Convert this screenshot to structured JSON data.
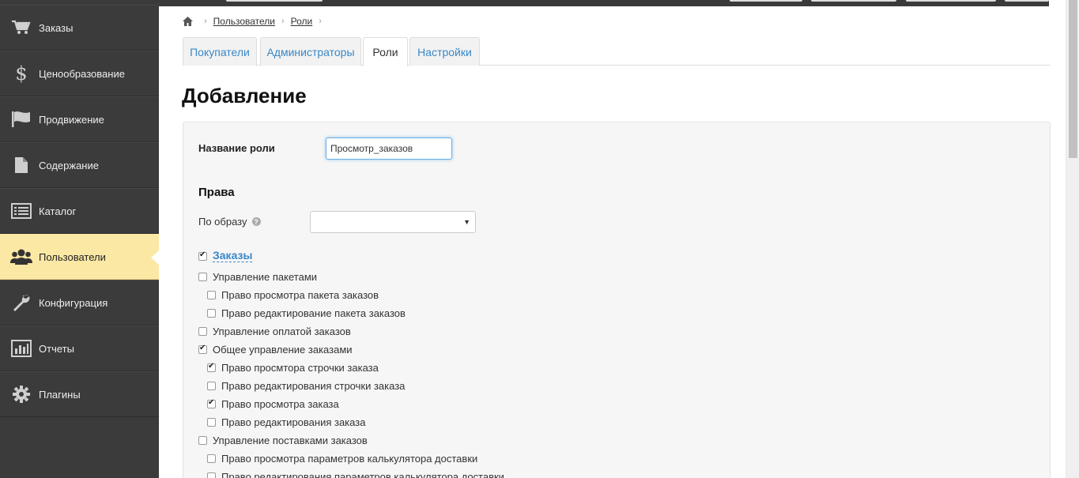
{
  "sidebar": {
    "items": [
      {
        "label": "Заказы",
        "icon": "cart-icon"
      },
      {
        "label": "Ценообразование",
        "icon": "dollar-icon"
      },
      {
        "label": "Продвижение",
        "icon": "flag-icon"
      },
      {
        "label": "Содержание",
        "icon": "document-icon"
      },
      {
        "label": "Каталог",
        "icon": "list-icon"
      },
      {
        "label": "Пользователи",
        "icon": "users-icon",
        "active": true
      },
      {
        "label": "Конфигурация",
        "icon": "wrench-icon"
      },
      {
        "label": "Отчеты",
        "icon": "bar-chart-icon"
      },
      {
        "label": "Плагины",
        "icon": "gear-icon"
      }
    ]
  },
  "breadcrumb": {
    "home_icon": "home-icon",
    "items": [
      "Пользователи",
      "Роли"
    ]
  },
  "tabs": [
    {
      "label": "Покупатели"
    },
    {
      "label": "Администраторы"
    },
    {
      "label": "Роли",
      "active": true
    },
    {
      "label": "Настройки"
    }
  ],
  "page": {
    "title": "Добавление"
  },
  "form": {
    "role_name_label": "Название роли",
    "role_name_value": "Просмотр_заказов",
    "rights_title": "Права",
    "template_label": "По образу",
    "template_value": ""
  },
  "permissions": {
    "group_label": "Заказы",
    "group_checked": true,
    "items": [
      {
        "label": "Управление пакетами",
        "checked": false,
        "level": 1
      },
      {
        "label": "Право просмотра пакета заказов",
        "checked": false,
        "level": 2
      },
      {
        "label": "Право редактирование пакета заказов",
        "checked": false,
        "level": 2
      },
      {
        "label": "Управление оплатой заказов",
        "checked": false,
        "level": 1
      },
      {
        "label": "Общее управление заказами",
        "checked": true,
        "level": 1
      },
      {
        "label": "Право просмтора строчки заказа",
        "checked": true,
        "level": 2
      },
      {
        "label": "Право редактирования строчки заказа",
        "checked": false,
        "level": 2
      },
      {
        "label": "Право просмотра заказа",
        "checked": true,
        "level": 2
      },
      {
        "label": "Право редактирования заказа",
        "checked": false,
        "level": 2
      },
      {
        "label": "Управление поставками заказов",
        "checked": false,
        "level": 1
      },
      {
        "label": "Право просмотра параметров калькулятора доставки",
        "checked": false,
        "level": 2
      },
      {
        "label": "Право редактирования параметров калькулятора доставки",
        "checked": false,
        "level": 2
      }
    ]
  },
  "colors": {
    "sidebar_bg": "#3b3b3b",
    "active_item": "#fbe8a4",
    "link": "#3a87c7",
    "focus": "#66afe9"
  }
}
